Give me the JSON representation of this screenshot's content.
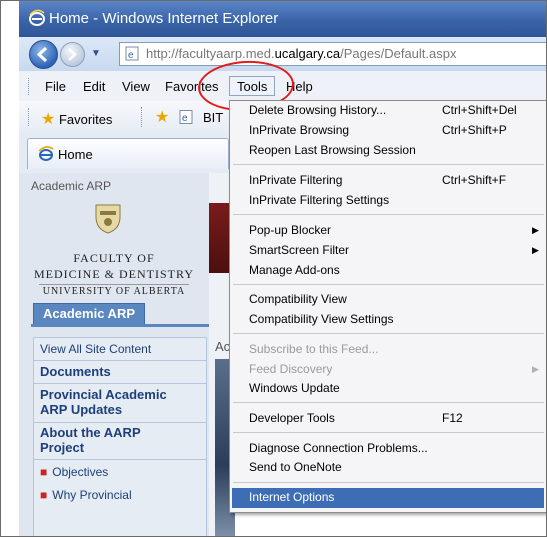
{
  "window": {
    "title": "Home - Windows Internet Explorer"
  },
  "address": {
    "url_prefix": "http://facultyaarp.med.",
    "url_domain": "ucalgary.ca",
    "url_suffix": "/Pages/Default.aspx"
  },
  "menubar": {
    "file": "File",
    "edit": "Edit",
    "view": "View",
    "favorites": "Favorites",
    "tools": "Tools",
    "help": "Help"
  },
  "favbar": {
    "favorites": "Favorites",
    "link": "BIT"
  },
  "tab": {
    "label": "Home"
  },
  "page": {
    "site_label": "Academic ARP",
    "faculty_line1": "FACULTY OF",
    "faculty_line2": "MEDICINE & DENTISTRY",
    "university": "UNIVERSITY OF ALBERTA",
    "active_tab": "Academic ARP",
    "nav": {
      "view_all": "View All Site Content",
      "documents": "Documents",
      "provincial_1": "Provincial Academic",
      "provincial_2": "ARP Updates",
      "about_1": "About the AARP",
      "about_2": "Project",
      "objectives": "Objectives",
      "why_provincial": "Why Provincial"
    },
    "photo_label": "Ac"
  },
  "tools_menu": {
    "items": [
      {
        "label": "Delete Browsing History...",
        "shortcut": "Ctrl+Shift+Del"
      },
      {
        "label": "InPrivate Browsing",
        "shortcut": "Ctrl+Shift+P"
      },
      {
        "label": "Reopen Last Browsing Session",
        "shortcut": ""
      },
      {
        "label": "InPrivate Filtering",
        "shortcut": "Ctrl+Shift+F"
      },
      {
        "label": "InPrivate Filtering Settings",
        "shortcut": ""
      },
      {
        "label": "Pop-up Blocker",
        "shortcut": ""
      },
      {
        "label": "SmartScreen Filter",
        "shortcut": ""
      },
      {
        "label": "Manage Add-ons",
        "shortcut": ""
      },
      {
        "label": "Compatibility View",
        "shortcut": ""
      },
      {
        "label": "Compatibility View Settings",
        "shortcut": ""
      },
      {
        "label": "Subscribe to this Feed...",
        "shortcut": ""
      },
      {
        "label": "Feed Discovery",
        "shortcut": ""
      },
      {
        "label": "Windows Update",
        "shortcut": ""
      },
      {
        "label": "Developer Tools",
        "shortcut": "F12"
      },
      {
        "label": "Diagnose Connection Problems...",
        "shortcut": ""
      },
      {
        "label": "Send to OneNote",
        "shortcut": ""
      },
      {
        "label": "Internet Options",
        "shortcut": ""
      }
    ]
  },
  "colors": {
    "titlebar": "#3a64a8",
    "highlight": "#3d6eb5",
    "annotation": "#e21b1b",
    "nav_link": "#1d3f7a"
  }
}
